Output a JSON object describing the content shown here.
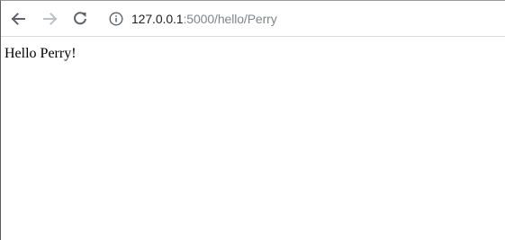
{
  "address_bar": {
    "url_host": "127.0.0.1",
    "url_path": ":5000/hello/Perry"
  },
  "icons": {
    "back": "arrow-left-icon",
    "forward": "arrow-right-icon",
    "reload": "reload-icon",
    "site_info": "info-icon"
  },
  "colors": {
    "icon_active": "#5f6368",
    "icon_disabled": "#bdc1c6",
    "url_path": "#80868b"
  },
  "page": {
    "greeting": "Hello Perry!"
  }
}
